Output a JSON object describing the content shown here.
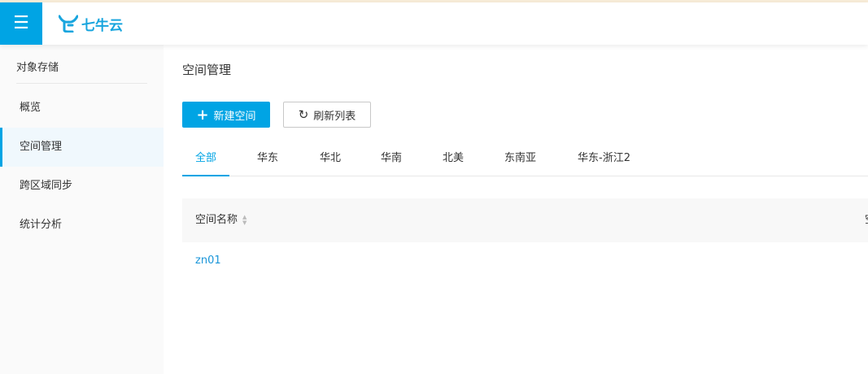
{
  "header": {
    "logo_text": "七牛云",
    "menu_icon": "☰"
  },
  "sidebar": {
    "title": "对象存储",
    "items": [
      {
        "label": "概览"
      },
      {
        "label": "空间管理"
      },
      {
        "label": "跨区域同步"
      },
      {
        "label": "统计分析"
      }
    ]
  },
  "main": {
    "title": "空间管理",
    "new_button": "新建空间",
    "refresh_button": "刷新列表",
    "tabs": [
      {
        "label": "全部"
      },
      {
        "label": "华东"
      },
      {
        "label": "华北"
      },
      {
        "label": "华南"
      },
      {
        "label": "北美"
      },
      {
        "label": "东南亚"
      },
      {
        "label": "华东-浙江2"
      }
    ],
    "table": {
      "columns": [
        "空间名称",
        "空间"
      ],
      "rows": [
        {
          "name": "zn01"
        }
      ]
    }
  },
  "colors": {
    "accent": "#00a4e4"
  }
}
